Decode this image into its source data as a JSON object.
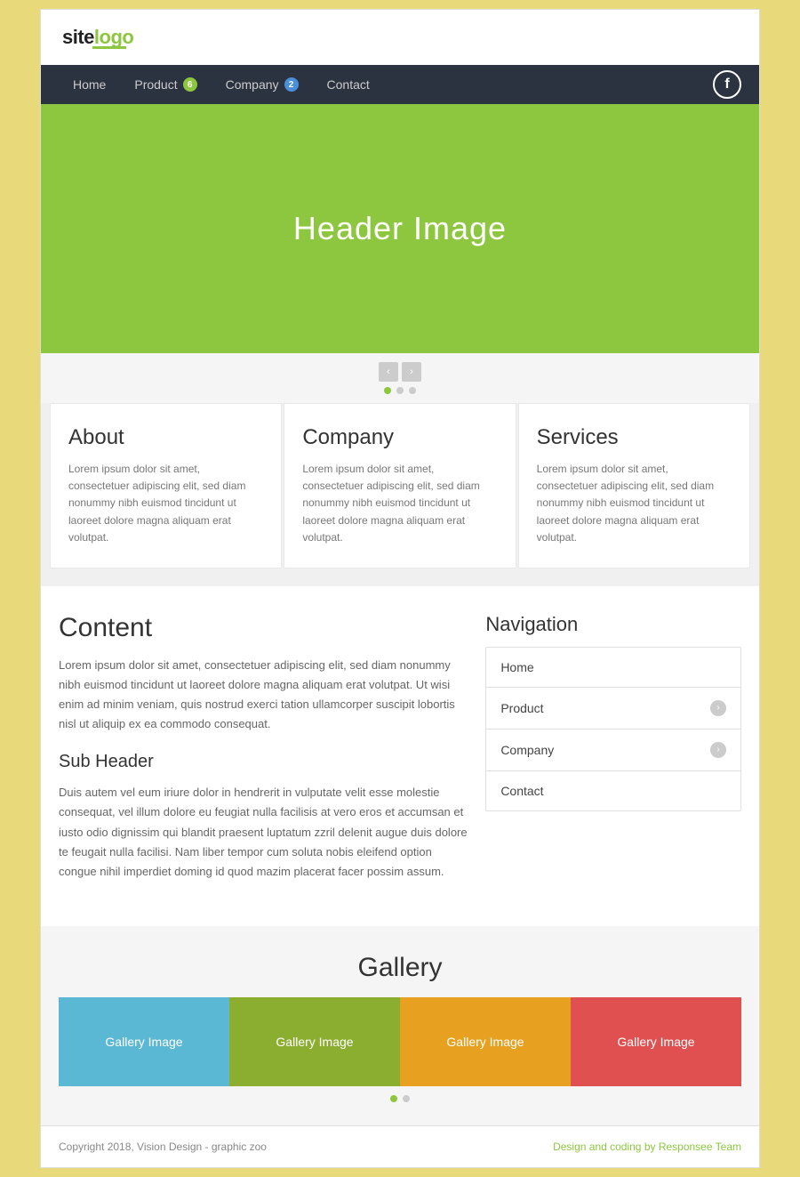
{
  "site": {
    "logo_text": "site",
    "logo_accent": "logo",
    "title": "SiteLogo"
  },
  "nav": {
    "items": [
      {
        "label": "Home",
        "badge": null
      },
      {
        "label": "Product",
        "badge": "6"
      },
      {
        "label": "Company",
        "badge": "2"
      },
      {
        "label": "Contact",
        "badge": null
      }
    ],
    "facebook_icon": "f"
  },
  "hero": {
    "title": "Header Image"
  },
  "slider": {
    "prev_label": "‹",
    "next_label": "›",
    "dots": 3
  },
  "cards": [
    {
      "title": "About",
      "text": "Lorem ipsum dolor sit amet, consectetuer adipiscing elit, sed diam nonummy nibh euismod tincidunt ut laoreet dolore magna aliquam erat volutpat."
    },
    {
      "title": "Company",
      "text": "Lorem ipsum dolor sit amet, consectetuer adipiscing elit, sed diam nonummy nibh euismod tincidunt ut laoreet dolore magna aliquam erat volutpat."
    },
    {
      "title": "Services",
      "text": "Lorem ipsum dolor sit amet, consectetuer adipiscing elit, sed diam nonummy nibh euismod tincidunt ut laoreet dolore magna aliquam erat volutpat."
    }
  ],
  "content": {
    "title": "Content",
    "paragraph": "Lorem ipsum dolor sit amet, consectetuer adipiscing elit, sed diam nonummy nibh euismod tincidunt ut laoreet dolore magna aliquam erat volutpat. Ut wisi enim ad minim veniam, quis nostrud exerci tation ullamcorper suscipit lobortis nisl ut aliquip ex ea commodo consequat.",
    "sub_header": "Sub Header",
    "sub_paragraph": "Duis autem vel eum iriure dolor in hendrerit in vulputate velit esse molestie consequat, vel illum dolore eu feugiat nulla facilisis at vero eros et accumsan et iusto odio dignissim qui blandit praesent luptatum zzril delenit augue duis dolore te feugait nulla facilisi. Nam liber tempor cum soluta nobis eleifend option congue nihil imperdiet doming id quod mazim placerat facer possim assum."
  },
  "sidebar_nav": {
    "title": "Navigation",
    "items": [
      {
        "label": "Home",
        "has_arrow": false
      },
      {
        "label": "Product",
        "has_arrow": true
      },
      {
        "label": "Company",
        "has_arrow": true
      },
      {
        "label": "Contact",
        "has_arrow": false
      }
    ]
  },
  "gallery": {
    "title": "Gallery",
    "items": [
      {
        "label": "Gallery Image",
        "color_class": "blue"
      },
      {
        "label": "Gallery Image",
        "color_class": "olive"
      },
      {
        "label": "Gallery Image",
        "color_class": "yellow"
      },
      {
        "label": "Gallery Image",
        "color_class": "red"
      }
    ],
    "dots": 2
  },
  "footer": {
    "copyright": "Copyright 2018, Vision Design - graphic zoo",
    "credit": "Design and coding by Responsee Team"
  }
}
